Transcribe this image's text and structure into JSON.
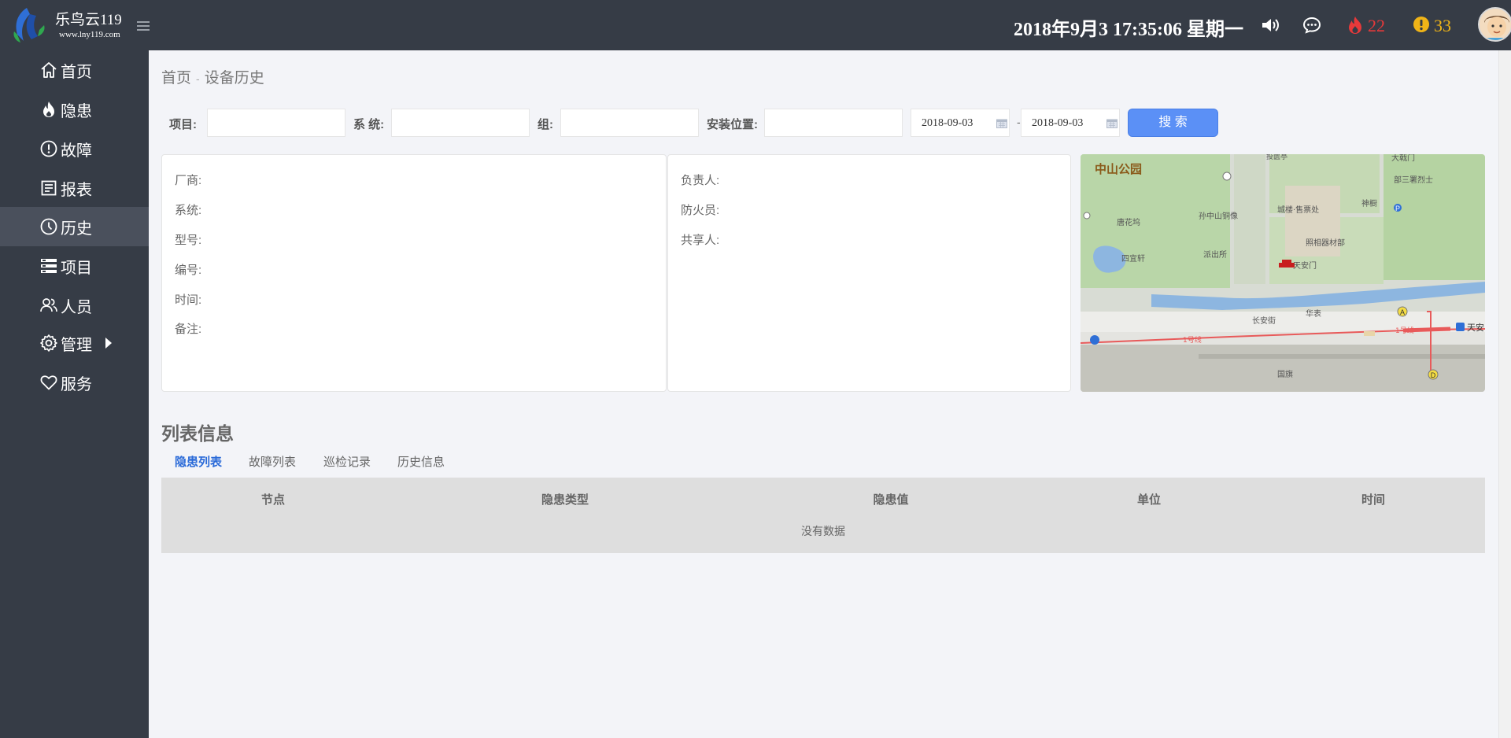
{
  "header": {
    "brand_name": "乐鸟云119",
    "brand_url": "www.lny119.com",
    "datetime": "2018年9月3 17:35:06 星期一",
    "hazard_count": "22",
    "alarm_count": "33",
    "colors": {
      "bar": "#363c46",
      "hazard": "#e8393a",
      "alarm": "#f0b417"
    }
  },
  "sidebar": {
    "items": [
      {
        "label": "首页",
        "icon": "home-icon"
      },
      {
        "label": "隐患",
        "icon": "fire-icon"
      },
      {
        "label": "故障",
        "icon": "alert-circle-icon"
      },
      {
        "label": "报表",
        "icon": "report-icon"
      },
      {
        "label": "历史",
        "icon": "clock-icon",
        "active": true
      },
      {
        "label": "项目",
        "icon": "project-icon"
      },
      {
        "label": "人员",
        "icon": "users-icon"
      },
      {
        "label": "管理",
        "icon": "gear-icon"
      },
      {
        "label": "服务",
        "icon": "heart-icon"
      }
    ]
  },
  "breadcrumb": {
    "home": "首页",
    "sep": "-",
    "current": "设备历史"
  },
  "search": {
    "project_label": "项目:",
    "system_label": "系 统:",
    "group_label": "组:",
    "location_label": "安装位置:",
    "project_value": "",
    "system_value": "",
    "group_value": "",
    "location_value": "",
    "start_date": "2018-09-03",
    "end_date": "2018-09-03",
    "date_sep": "-",
    "button_label": "搜 索"
  },
  "device_info": {
    "vendor_label": "厂商:",
    "system_label": "系统:",
    "model_label": "型号:",
    "code_label": "编号:",
    "time_label": "时间:",
    "remark_label": "备注:",
    "owner_label": "负责人:",
    "fire_officer_label": "防火员:",
    "sharer_label": "共享人:"
  },
  "map": {
    "park_title": "中山公园",
    "labels": {
      "gate_north": "大戟门",
      "bu_san": "部三署烈士",
      "shen_ku": "神橱",
      "tang_hua": "唐花坞",
      "sun_statue": "孙中山铜像",
      "cheng_lou": "城楼·售票处",
      "photo_shop": "照相器材部",
      "si_yi": "四宜轩",
      "police": "派出所",
      "tiananmen": "天安门",
      "chang_an": "长安街",
      "hua_biao": "华表",
      "flag": "国旗",
      "line1_a": "1号线",
      "line1_b": "1号线",
      "tian_station": "天安",
      "top_cut": "投匮亭"
    }
  },
  "list": {
    "title": "列表信息",
    "tabs": [
      "隐患列表",
      "故障列表",
      "巡检记录",
      "历史信息"
    ],
    "active_tab": 0,
    "columns": [
      "节点",
      "隐患类型",
      "隐患值",
      "单位",
      "时间"
    ],
    "empty_text": "没有数据"
  }
}
